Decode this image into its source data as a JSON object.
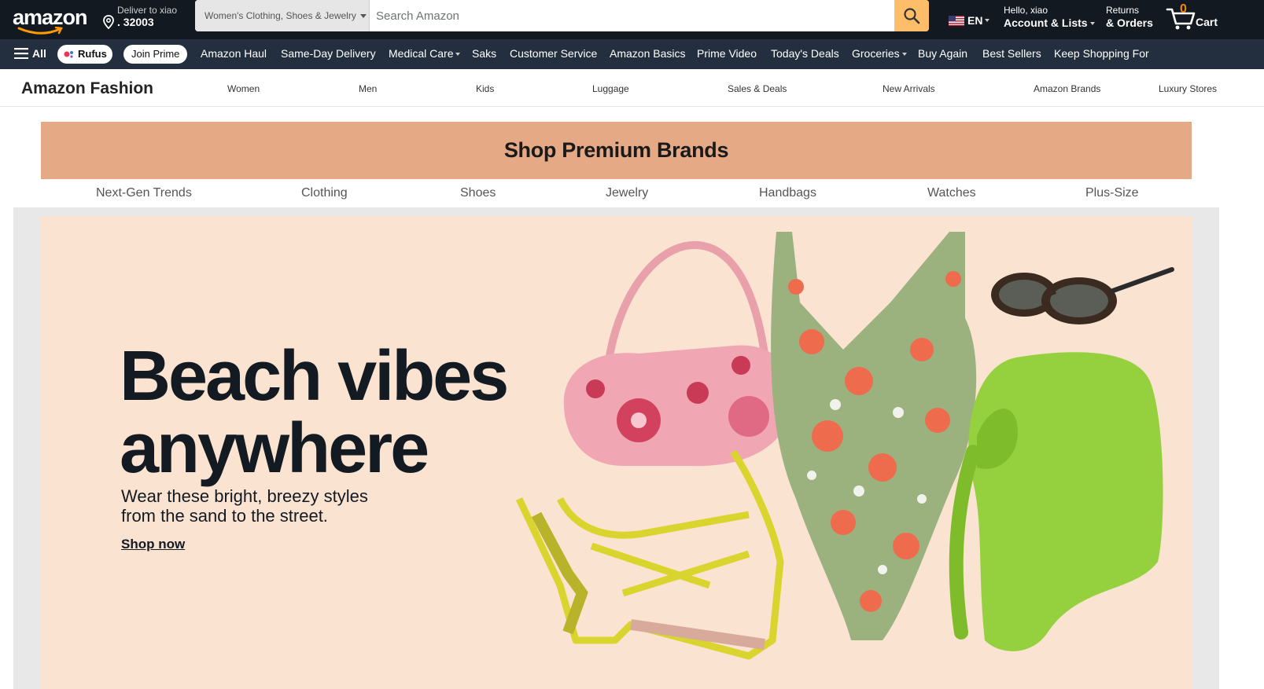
{
  "topnav": {
    "logo_text": "amazon",
    "deliver_line1": "Deliver to xiao",
    "deliver_line2": "32003",
    "search_category": "Women's Clothing, Shoes & Jewelry",
    "search_placeholder": "Search Amazon",
    "language": "EN",
    "account_line1": "Hello, xiao",
    "account_line2": "Account & Lists",
    "returns_line1": "Returns",
    "returns_line2": "& Orders",
    "cart_count": "0",
    "cart_label": "Cart"
  },
  "subnav": {
    "all_label": "All",
    "rufus_label": "Rufus",
    "prime_label": "Join Prime",
    "items": [
      "Amazon Haul",
      "Same-Day Delivery",
      "Medical Care",
      "Saks",
      "Customer Service",
      "Amazon Basics",
      "Prime Video",
      "Today's Deals",
      "Groceries",
      "Buy Again",
      "Best Sellers",
      "Keep Shopping For"
    ]
  },
  "fashion": {
    "brand": "Amazon Fashion",
    "links": [
      "Women",
      "Men",
      "Kids",
      "Luggage",
      "Sales & Deals",
      "New Arrivals",
      "Amazon Brands",
      "Luxury Stores"
    ]
  },
  "premium": {
    "title": "Shop Premium Brands",
    "categories": [
      "Next-Gen Trends",
      "Clothing",
      "Shoes",
      "Jewelry",
      "Handbags",
      "Watches",
      "Plus-Size"
    ]
  },
  "hero": {
    "headline_line1": "Beach vibes",
    "headline_line2": "anywhere",
    "subtitle_line1": "Wear these bright, breezy styles",
    "subtitle_line2": "from the sand to the street.",
    "cta": "Shop now"
  },
  "colors": {
    "nav_dark": "#131921",
    "subnav": "#232f3e",
    "search_button": "#febd69",
    "premium_banner": "#e5a986",
    "hero_bg": "#fbe3d2"
  },
  "icons": [
    "location-pin-icon",
    "search-icon",
    "us-flag-icon",
    "cart-icon",
    "hamburger-icon",
    "rufus-icon"
  ]
}
